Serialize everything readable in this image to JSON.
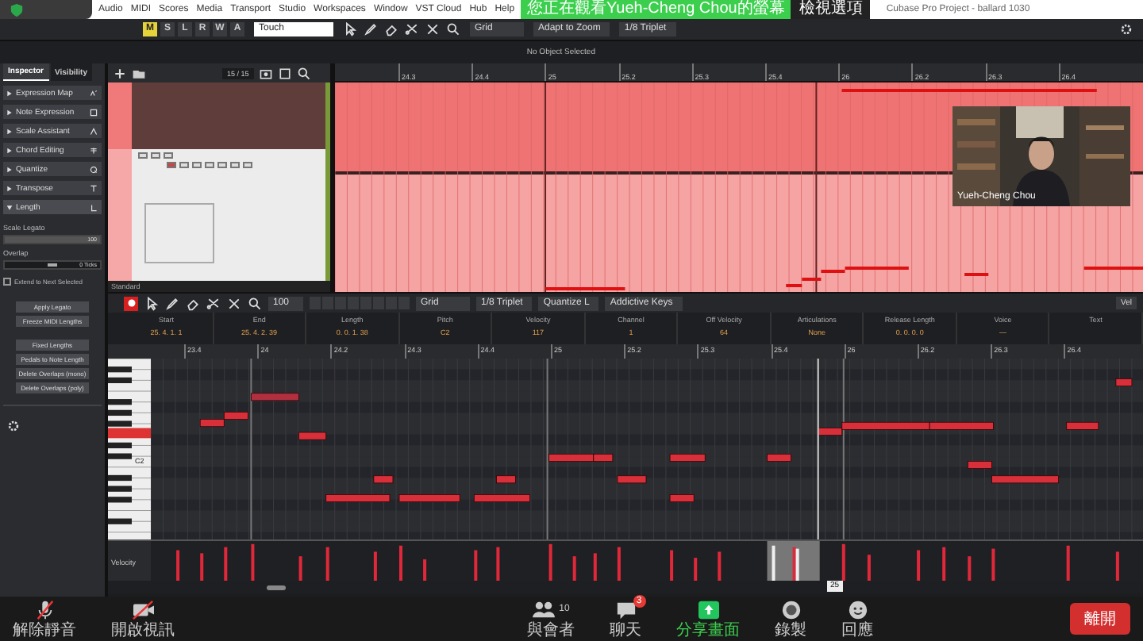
{
  "screen_share": {
    "banner": "您正在觀看Yueh-Cheng Chou的螢幕",
    "view_options": "檢視選項"
  },
  "menu": [
    "Audio",
    "MIDI",
    "Scores",
    "Media",
    "Transport",
    "Studio",
    "Workspaces",
    "Window",
    "VST Cloud",
    "Hub",
    "Help"
  ],
  "window_title": "Cubase Pro Project - ballard 1030",
  "toolbar": {
    "track_buttons": [
      {
        "label": "M",
        "selected": true
      },
      {
        "label": "S",
        "selected": false
      },
      {
        "label": "L",
        "selected": false
      },
      {
        "label": "R",
        "selected": false
      },
      {
        "label": "W",
        "selected": false
      },
      {
        "label": "A",
        "selected": false
      }
    ],
    "automation_mode": "Touch",
    "snap_type": "Grid",
    "grid": "Adapt to Zoom",
    "quantize": "1/8 Triplet"
  },
  "status": "No Object Selected",
  "inspector": {
    "tabs": [
      {
        "label": "Inspector",
        "selected": true
      },
      {
        "label": "Visibility",
        "selected": false
      }
    ],
    "sections": [
      {
        "label": "Expression Map",
        "expanded": false
      },
      {
        "label": "Note Expression",
        "expanded": false
      },
      {
        "label": "Scale Assistant",
        "expanded": false
      },
      {
        "label": "Chord Editing",
        "expanded": false
      },
      {
        "label": "Quantize",
        "expanded": false
      },
      {
        "label": "Transpose",
        "expanded": false
      },
      {
        "label": "Length",
        "expanded": true
      }
    ],
    "scale_legato": {
      "label": "Scale Legato",
      "level": 1,
      "reading": "100"
    },
    "overlap": {
      "label": "Overlap",
      "level": 0.5,
      "reading": "0 Ticks"
    },
    "extend": {
      "label": "Extend to Next Selected",
      "checked": false
    },
    "buttons": [
      "Apply Legato",
      "Freeze MIDI Lengths",
      "Fixed Lengths",
      "Pedals to Note Length",
      "Delete Overlaps (mono)",
      "Delete Overlaps (poly)"
    ]
  },
  "track_list": {
    "counter": "15 / 15",
    "preset": "Standard"
  },
  "project_ruler": [
    "24.3",
    "24.4",
    "25",
    "25.2",
    "25.3",
    "25.4",
    "26",
    "26.2",
    "26.3",
    "26.4"
  ],
  "video": {
    "caption": "Yueh-Cheng Chou"
  },
  "editor_toolbar": {
    "velocity": "100",
    "snap_type": "Grid",
    "quantize": "1/8 Triplet",
    "length_quantize": "Quantize L",
    "instrument": "Addictive Keys",
    "lane": "Vel"
  },
  "info_line": [
    {
      "label": "Start",
      "value": "25. 4. 1. 1"
    },
    {
      "label": "End",
      "value": "25. 4. 2. 39"
    },
    {
      "label": "Length",
      "value": "0. 0. 1. 38"
    },
    {
      "label": "Pitch",
      "value": "C2"
    },
    {
      "label": "Velocity",
      "value": "117"
    },
    {
      "label": "Channel",
      "value": "1"
    },
    {
      "label": "Off Velocity",
      "value": "64"
    },
    {
      "label": "Articulations",
      "value": "None"
    },
    {
      "label": "Release Length",
      "value": "0. 0. 0. 0"
    },
    {
      "label": "Voice",
      "value": "—"
    },
    {
      "label": "Text"
    }
  ],
  "editor_ruler": [
    "23.4",
    "24",
    "24.2",
    "24.3",
    "24.4",
    "25",
    "25.2",
    "25.3",
    "25.4",
    "26",
    "26.2",
    "26.3",
    "26.4"
  ],
  "keyboard_label": "C2",
  "velocity_lane": {
    "label": "Velocity"
  },
  "position_marker": "25",
  "meeting_controls": [
    {
      "label": "解除靜音",
      "kind": "mic"
    },
    {
      "label": "開啟視訊",
      "kind": "video"
    },
    {
      "label": "與會者",
      "kind": "participants",
      "count": "10"
    },
    {
      "label": "聊天",
      "kind": "chat",
      "badge": "3"
    },
    {
      "label": "分享畫面",
      "kind": "share"
    },
    {
      "label": "錄製",
      "kind": "record"
    },
    {
      "label": "回應",
      "kind": "reactions"
    }
  ],
  "leave_button": "離開"
}
